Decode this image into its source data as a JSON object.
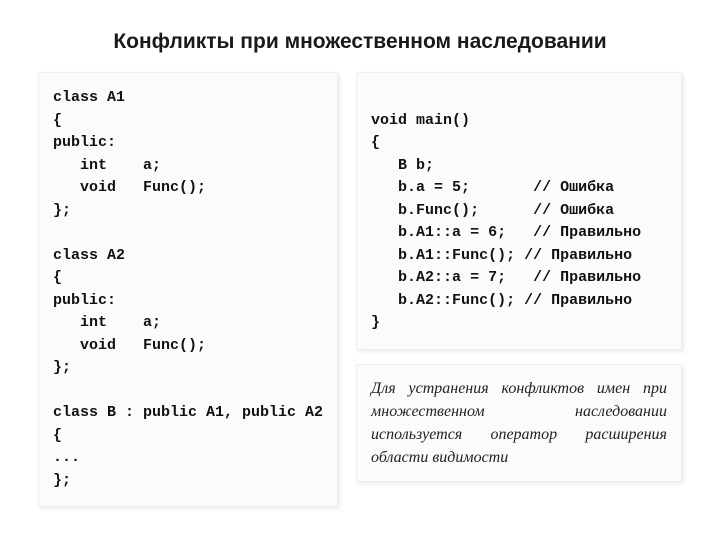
{
  "title": "Конфликты при множественном наследовании",
  "codeLeft": "class A1\n{\npublic:\n   int    a;\n   void   Func();\n};\n\nclass A2\n{\npublic:\n   int    a;\n   void   Func();\n};\n\nclass B : public A1, public A2\n{\n...\n};",
  "codeRight": "\nvoid main()\n{\n   B b;\n   b.a = 5;       // Ошибка\n   b.Func();      // Ошибка\n   b.A1::a = 6;   // Правильно\n   b.A1::Func(); // Правильно\n   b.A2::a = 7;   // Правильно\n   b.A2::Func(); // Правильно\n}",
  "note": "Для устранения конфликтов имен при множественном наследовании используется оператор расширения области видимости"
}
